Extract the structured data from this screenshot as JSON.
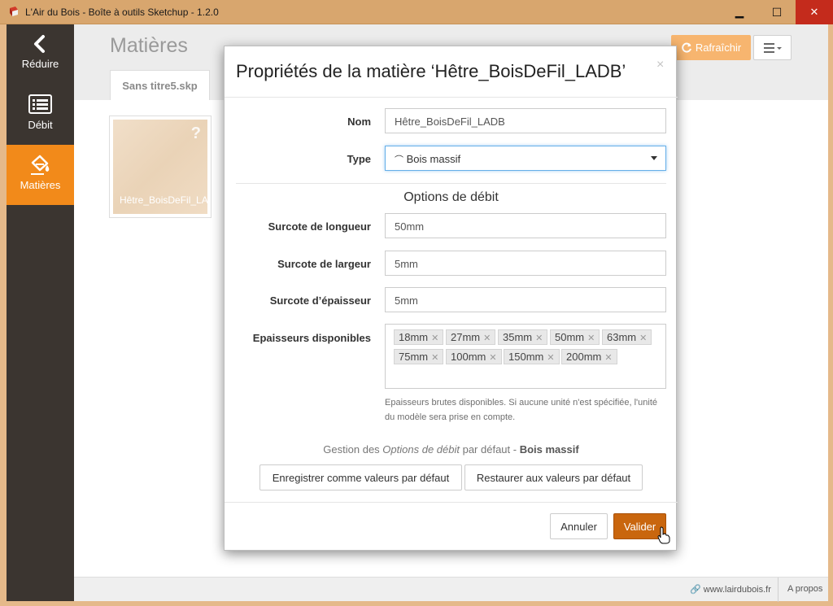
{
  "window": {
    "title": "L'Air du Bois - Boîte à outils Sketchup - 1.2.0",
    "minimize": "▁",
    "maximize": "☐",
    "close": "✕"
  },
  "sidebar": {
    "items": [
      {
        "label": "Réduire",
        "icon": "chevron-left-icon"
      },
      {
        "label": "Débit",
        "icon": "list-icon"
      },
      {
        "label": "Matières",
        "icon": "paint-bucket-icon",
        "active": true
      }
    ]
  },
  "header": {
    "title": "Matières",
    "tab": "Sans titre5.skp",
    "refresh_label": "Rafraîchir",
    "menu_icon": "hamburger-icon"
  },
  "material_card": {
    "name": "Hêtre_BoisDeFil_LADB",
    "badge": "?"
  },
  "status": {
    "link": "www.lairdubois.fr",
    "about": "A propos"
  },
  "modal": {
    "title": "Propriétés de la matière ‘Hêtre_BoisDeFil_LADB’",
    "close": "×",
    "name_label": "Nom",
    "name_value": "Hêtre_BoisDeFil_LADB",
    "type_label": "Type",
    "type_value": "Bois massif",
    "section_title": "Options de débit",
    "length_label": "Surcote de longueur",
    "length_value": "50mm",
    "width_label": "Surcote de largeur",
    "width_value": "5mm",
    "thickness_label": "Surcote d’épaisseur",
    "thickness_value": "5mm",
    "thicknesses_label": "Epaisseurs disponibles",
    "thicknesses": [
      "18mm",
      "27mm",
      "35mm",
      "50mm",
      "63mm",
      "75mm",
      "100mm",
      "150mm",
      "200mm"
    ],
    "help": "Epaisseurs brutes disponibles. Si aucune unité n'est spécifiée, l'unité du modèle sera prise en compte.",
    "defaults_prefix": "Gestion des ",
    "defaults_em": "Options de débit",
    "defaults_mid": " par défaut - ",
    "defaults_type": "Bois massif",
    "save_defaults": "Enregistrer comme valeurs par défaut",
    "restore_defaults": "Restaurer aux valeurs par défaut",
    "cancel": "Annuler",
    "validate": "Valider"
  },
  "colors": {
    "accent": "#f28a1a",
    "primary_button": "#c9660e",
    "sidebar": "#3b3530"
  }
}
